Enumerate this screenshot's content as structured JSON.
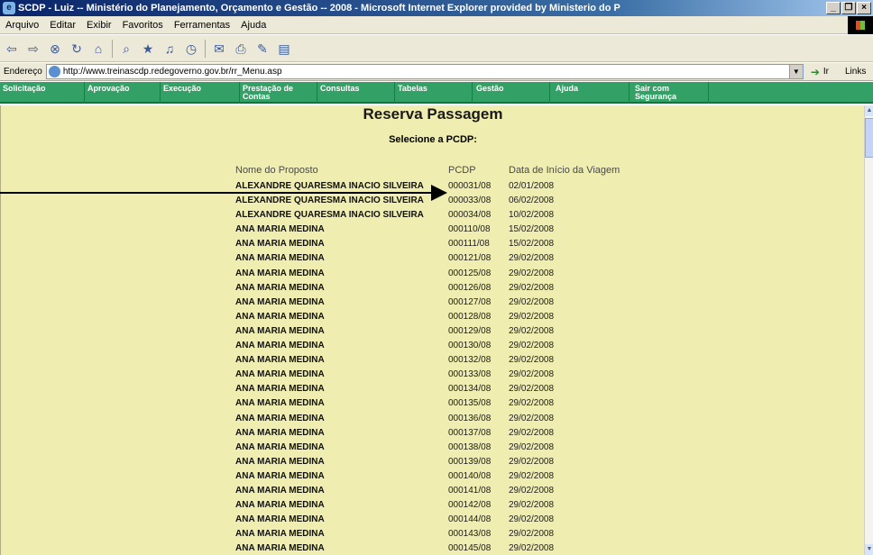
{
  "window": {
    "title": "SCDP - Luiz -- Ministério do Planejamento, Orçamento e Gestão -- 2008 - Microsoft Internet Explorer provided by Ministerio do P",
    "buttons": [
      "_",
      "❐",
      "×"
    ]
  },
  "menu": [
    "Arquivo",
    "Editar",
    "Exibir",
    "Favoritos",
    "Ferramentas",
    "Ajuda"
  ],
  "address": {
    "label": "Endereço",
    "url": "http://www.treinascdp.redegoverno.gov.br/rr_Menu.asp",
    "go": "Ir",
    "links": "Links"
  },
  "nav": [
    "Solicitação",
    "Aprovação",
    "Execução",
    "Prestação de Contas",
    "Consultas",
    "Tabelas",
    "Gestão",
    "Ajuda",
    "Sair com Segurança"
  ],
  "page": {
    "title": "Reserva Passagem",
    "subtitle": "Selecione a PCDP:",
    "columns": {
      "nome": "Nome do Proposto",
      "pcdp": "PCDP",
      "data": "Data de Início da Viagem"
    },
    "rows": [
      {
        "nome": "ALEXANDRE QUARESMA INACIO SILVEIRA",
        "pcdp": "000031/08",
        "data": "02/01/2008"
      },
      {
        "nome": "ALEXANDRE QUARESMA INACIO SILVEIRA",
        "pcdp": "000033/08",
        "data": "06/02/2008"
      },
      {
        "nome": "ALEXANDRE QUARESMA INACIO SILVEIRA",
        "pcdp": "000034/08",
        "data": "10/02/2008"
      },
      {
        "nome": "ANA MARIA MEDINA",
        "pcdp": "000110/08",
        "data": "15/02/2008"
      },
      {
        "nome": "ANA MARIA MEDINA",
        "pcdp": "000111/08",
        "data": "15/02/2008"
      },
      {
        "nome": "ANA MARIA MEDINA",
        "pcdp": "000121/08",
        "data": "29/02/2008"
      },
      {
        "nome": "ANA MARIA MEDINA",
        "pcdp": "000125/08",
        "data": "29/02/2008"
      },
      {
        "nome": "ANA MARIA MEDINA",
        "pcdp": "000126/08",
        "data": "29/02/2008"
      },
      {
        "nome": "ANA MARIA MEDINA",
        "pcdp": "000127/08",
        "data": "29/02/2008"
      },
      {
        "nome": "ANA MARIA MEDINA",
        "pcdp": "000128/08",
        "data": "29/02/2008"
      },
      {
        "nome": "ANA MARIA MEDINA",
        "pcdp": "000129/08",
        "data": "29/02/2008"
      },
      {
        "nome": "ANA MARIA MEDINA",
        "pcdp": "000130/08",
        "data": "29/02/2008"
      },
      {
        "nome": "ANA MARIA MEDINA",
        "pcdp": "000132/08",
        "data": "29/02/2008"
      },
      {
        "nome": "ANA MARIA MEDINA",
        "pcdp": "000133/08",
        "data": "29/02/2008"
      },
      {
        "nome": "ANA MARIA MEDINA",
        "pcdp": "000134/08",
        "data": "29/02/2008"
      },
      {
        "nome": "ANA MARIA MEDINA",
        "pcdp": "000135/08",
        "data": "29/02/2008"
      },
      {
        "nome": "ANA MARIA MEDINA",
        "pcdp": "000136/08",
        "data": "29/02/2008"
      },
      {
        "nome": "ANA MARIA MEDINA",
        "pcdp": "000137/08",
        "data": "29/02/2008"
      },
      {
        "nome": "ANA MARIA MEDINA",
        "pcdp": "000138/08",
        "data": "29/02/2008"
      },
      {
        "nome": "ANA MARIA MEDINA",
        "pcdp": "000139/08",
        "data": "29/02/2008"
      },
      {
        "nome": "ANA MARIA MEDINA",
        "pcdp": "000140/08",
        "data": "29/02/2008"
      },
      {
        "nome": "ANA MARIA MEDINA",
        "pcdp": "000141/08",
        "data": "29/02/2008"
      },
      {
        "nome": "ANA MARIA MEDINA",
        "pcdp": "000142/08",
        "data": "29/02/2008"
      },
      {
        "nome": "ANA MARIA MEDINA",
        "pcdp": "000144/08",
        "data": "29/02/2008"
      },
      {
        "nome": "ANA MARIA MEDINA",
        "pcdp": "000143/08",
        "data": "29/02/2008"
      },
      {
        "nome": "ANA MARIA MEDINA",
        "pcdp": "000145/08",
        "data": "29/02/2008"
      }
    ]
  }
}
